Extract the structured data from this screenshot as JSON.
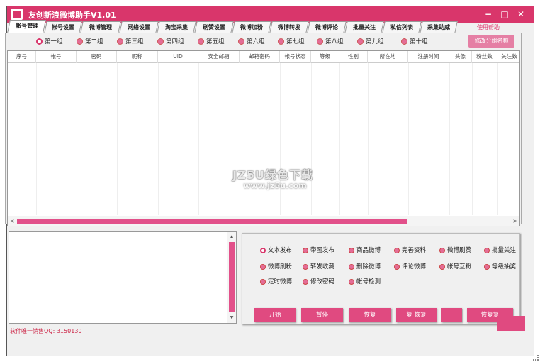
{
  "window": {
    "title": "友创新浪微博助手V1.01",
    "minimize": "−",
    "maximize": "□",
    "close": "✕"
  },
  "tabs": [
    "帐号管理",
    "帐号设置",
    "微博管理",
    "网络设置",
    "淘宝采集",
    "刷赞设置",
    "微博加粉",
    "微博转发",
    "微博评论",
    "批量关注",
    "私信列表",
    "采集助威"
  ],
  "help_link": "使用帮助",
  "groups": [
    "第一组",
    "第二组",
    "第三组",
    "第四组",
    "第五组",
    "第六组",
    "第七组",
    "第八组",
    "第九组",
    "第十组"
  ],
  "rename_button": "修改分组名称",
  "table": {
    "columns": [
      "序号",
      "帐号",
      "密码",
      "昵称",
      "UID",
      "安全邮箱",
      "邮箱密码",
      "帐号状态",
      "等级",
      "性别",
      "所在地",
      "注册时间",
      "头像",
      "粉丝数",
      "关注数"
    ]
  },
  "scroll": {
    "left_arrow": "<",
    "right_arrow": ">",
    "up_arrow": "▲",
    "down_arrow": "▼"
  },
  "contact": "软件唯一销售QQ: 3150130",
  "options": [
    "文本发布",
    "带图发布",
    "商品微博",
    "完善资料",
    "微博刷赞",
    "批量关注",
    "微博刷粉",
    "转发收藏",
    "删除微博",
    "评论微博",
    "帐号互粉",
    "等级抽奖",
    "定时微博",
    "修改密码",
    "帐号检测"
  ],
  "action_buttons": [
    "开始",
    "暂停",
    "恢复",
    "复 恢复",
    "",
    "恢复复"
  ],
  "watermark": {
    "line1": "JZ5U绿色下载",
    "line2": "www.jz5u.com"
  },
  "colors": {
    "accent": "#d9366b",
    "button": "#e04a80",
    "scroll_thumb": "#e2508a"
  }
}
